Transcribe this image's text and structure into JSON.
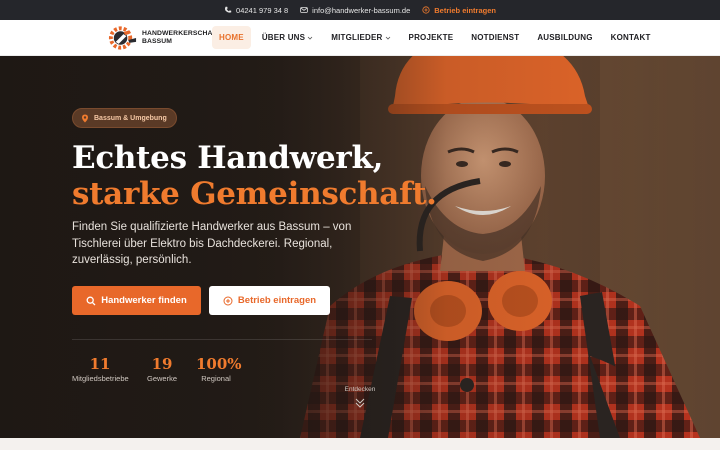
{
  "topbar": {
    "phone": "04241 979 34 8",
    "email": "info@handwerker-bassum.de",
    "cta": "Betrieb eintragen",
    "phone_icon": "phone-icon",
    "email_icon": "mail-icon",
    "cta_icon": "plus-circle-icon"
  },
  "brand": {
    "line1": "HANDWERKERSCHAFT",
    "line2": "BASSUM"
  },
  "nav": {
    "items": [
      {
        "label": "HOME",
        "active": true
      },
      {
        "label": "ÜBER UNS",
        "dropdown": true
      },
      {
        "label": "MITGLIEDER",
        "dropdown": true
      },
      {
        "label": "PROJEKTE"
      },
      {
        "label": "NOTDIENST"
      },
      {
        "label": "AUSBILDUNG"
      },
      {
        "label": "KONTAKT"
      }
    ]
  },
  "hero": {
    "badge": "Bassum & Umgebung",
    "headline_1": "Echtes Handwerk,",
    "headline_2": "starke Gemeinschaft.",
    "lead": "Finden Sie qualifizierte Handwerker aus Bassum – von Tischlerei über Elektro bis Dachdeckerei. Regional, zuverlässig, persönlich.",
    "primary_button": "Handwerker finden",
    "secondary_button": "Betrieb eintragen",
    "stats": [
      {
        "value": "11",
        "label": "Mitgliedsbetriebe"
      },
      {
        "value": "19",
        "label": "Gewerke"
      },
      {
        "value": "100%",
        "label": "Regional"
      }
    ],
    "discover": "Entdecken"
  },
  "colors": {
    "accent": "#e8682a",
    "topbar": "#25262b",
    "hero_bg": "#241c18"
  }
}
